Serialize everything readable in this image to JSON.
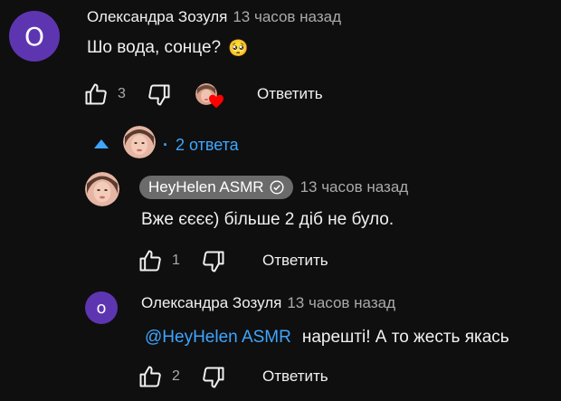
{
  "comment": {
    "avatar_letter": "О",
    "avatar_color": "#5e35b1",
    "author": "Олександра Зозуля",
    "time": "13 часов назад",
    "text": "Шо вода, сонце?",
    "emoji": "🥺",
    "like_count": "3",
    "reply_label": "Ответить"
  },
  "replies_toggle": {
    "separator": "·",
    "label": "2 ответа"
  },
  "replies": [
    {
      "author": "HeyHelen ASMR",
      "time": "13 часов назад",
      "text": "Вже єєєє) більше 2 діб не було.",
      "like_count": "1",
      "reply_label": "Ответить"
    },
    {
      "avatar_letter": "о",
      "avatar_color": "#5e35b1",
      "author": "Олександра Зозуля",
      "time": "13 часов назад",
      "mention": "@HeyHelen ASMR",
      "text": "нарешті! А то жесть якась",
      "like_count": "2",
      "reply_label": "Ответить"
    }
  ]
}
